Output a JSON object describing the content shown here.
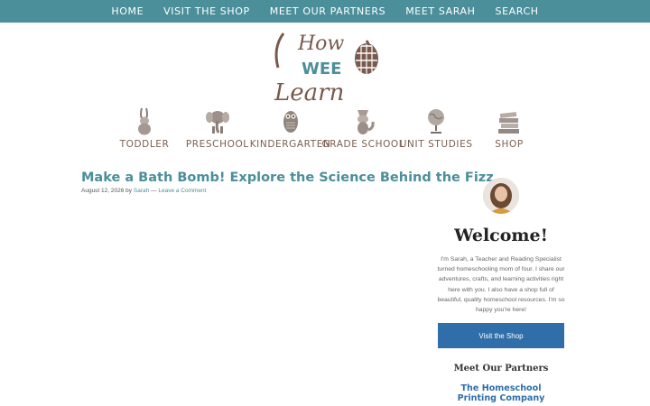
{
  "top_nav": {
    "items": [
      {
        "label": "HOME"
      },
      {
        "label": "VISIT THE SHOP"
      },
      {
        "label": "MEET OUR PARTNERS"
      },
      {
        "label": "MEET SARAH"
      },
      {
        "label": "SEARCH"
      }
    ]
  },
  "logo": {
    "line1": "How",
    "line2": "WEE",
    "line3": "Learn",
    "colors": {
      "brown": "#7a5a4d",
      "teal": "#4b8f9a"
    }
  },
  "categories": [
    {
      "label": "TODDLER",
      "icon": "rabbit-icon"
    },
    {
      "label": "PRESCHOOL",
      "icon": "elephant-icon"
    },
    {
      "label": "KINDERGARTEN",
      "icon": "owl-icon"
    },
    {
      "label": "GRADE SCHOOL",
      "icon": "fox-icon"
    },
    {
      "label": "UNIT STUDIES",
      "icon": "globe-icon"
    },
    {
      "label": "SHOP",
      "icon": "books-icon"
    }
  ],
  "post": {
    "title": "Make a Bath Bomb! Explore the Science Behind the Fizz",
    "date": "August 12, 2026",
    "by": "by",
    "author": "Sarah",
    "separator": "—",
    "comment_link": "Leave a Comment"
  },
  "sidebar": {
    "welcome": "Welcome!",
    "bio": "I'm Sarah, a Teacher and Reading Specialist turned homeschooling mom of four. I share our adventures, crafts, and learning activities right here with you. I also have a shop full of beautiful, quality homeschool resources. I'm so happy you're here!",
    "shop_button": "Visit the Shop",
    "partners_heading": "Meet Our Partners",
    "partner_logo_line1": "The Homeschool",
    "partner_logo_line2": "Printing Company"
  },
  "colors": {
    "accent": "#4b8f9a",
    "button": "#2f6ea8",
    "category_text": "#7a5f50"
  }
}
